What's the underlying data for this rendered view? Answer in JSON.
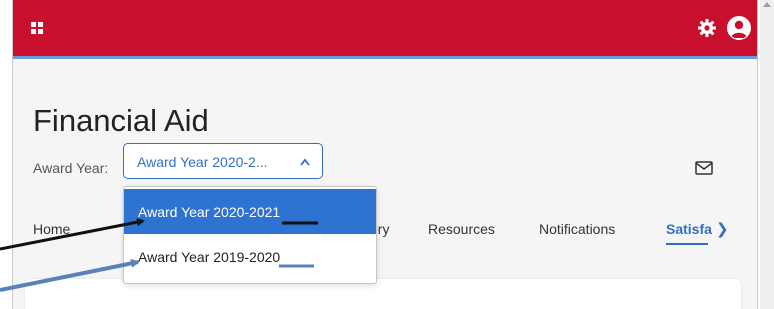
{
  "header": {
    "colors": {
      "brand": "#c8102e",
      "accent": "#6b9ad8"
    },
    "icons": {
      "menu": "grid-icon",
      "settings": "gear-icon",
      "profile": "avatar-icon"
    }
  },
  "page": {
    "title": "Financial Aid",
    "award_label": "Award Year:",
    "award_select_value": "Award Year 2020-2...",
    "mail_icon": "envelope-icon"
  },
  "tabs": [
    {
      "label": "Home"
    },
    {
      "label": "ory"
    },
    {
      "label": "Resources"
    },
    {
      "label": "Notifications"
    },
    {
      "label": "Satisfa",
      "active": true
    }
  ],
  "dropdown": {
    "options": [
      {
        "label": "Award Year 2020-2021",
        "selected": true
      },
      {
        "label": "Award Year 2019-2020",
        "selected": false
      }
    ]
  },
  "colors": {
    "link_blue": "#2f6fc9",
    "selected_bg": "#2f73d2"
  }
}
